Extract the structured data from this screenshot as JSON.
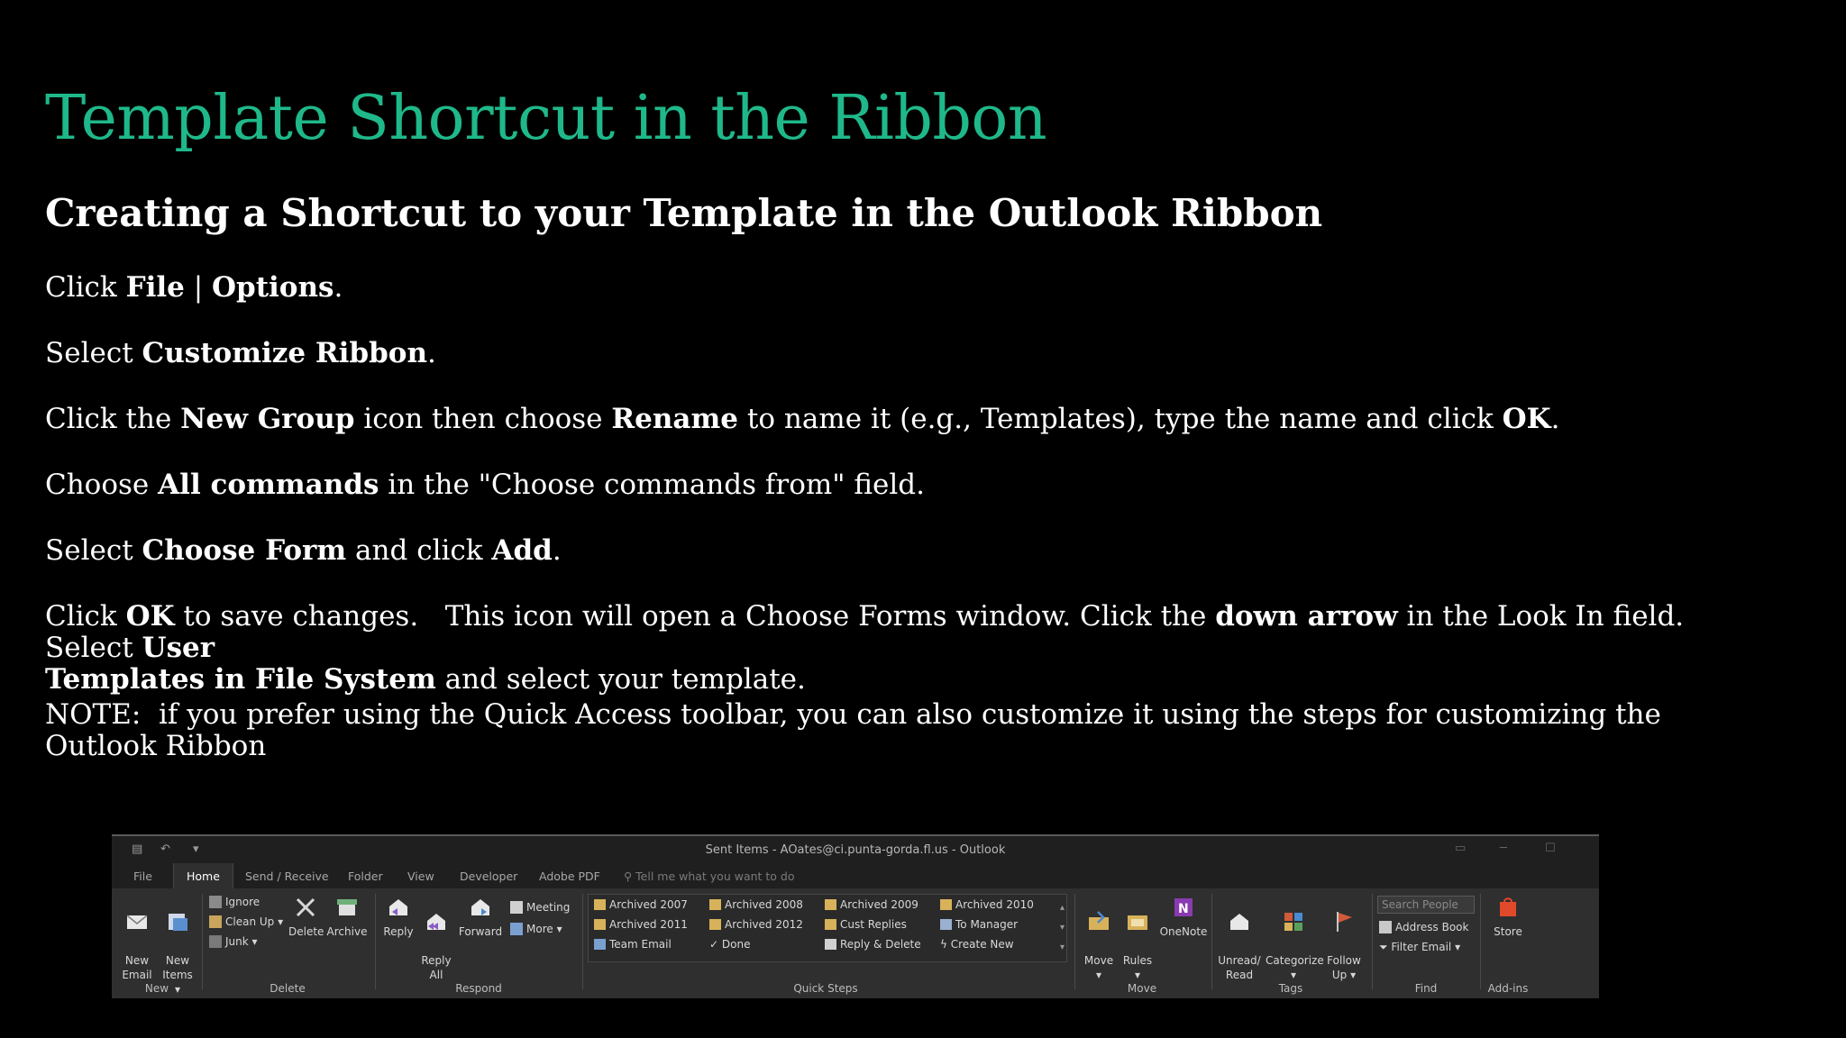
{
  "slide": {
    "title": "Template Shortcut in the Ribbon",
    "subtitle": "Creating a Shortcut to your Template in the Outlook Ribbon",
    "p1": {
      "a": "Click ",
      "b1": "File",
      "c": " | ",
      "b2": "Options",
      "d": "."
    },
    "p2": {
      "a": "Select ",
      "b1": "Customize Ribbon",
      "d": "."
    },
    "p3": {
      "a": "Click the ",
      "b1": "New Group",
      "c": " icon then choose ",
      "b2": "Rename",
      "e": " to name it (e.g., Templates), type the name and click ",
      "b3": "OK",
      "d": "."
    },
    "p4": {
      "a": "Choose ",
      "b1": "All commands",
      "c": " in the \"Choose commands from\" field."
    },
    "p5": {
      "a": "Select ",
      "b1": "Choose Form",
      "c": " and click ",
      "b2": "Add",
      "d": "."
    },
    "p6": {
      "a": "Click ",
      "b1": "OK",
      "c": " to save changes.   This icon will open a Choose Forms window. Click the ",
      "b2": "down arrow",
      "e": " in the Look In field.   Select ",
      "b3": "User",
      "f": "Templates in File System",
      "g": " and select your template."
    },
    "p7": "NOTE:  if you prefer using the Quick Access toolbar, you can also customize it using the steps for customizing the Outlook Ribbon"
  },
  "outlook": {
    "window_title": "Sent Items - AOates@ci.punta-gorda.fl.us - Outlook",
    "tabs": [
      "File",
      "Home",
      "Send / Receive",
      "Folder",
      "View",
      "Developer",
      "Adobe PDF"
    ],
    "tell_me": "Tell me what you want to do",
    "groups": {
      "new": {
        "label": "New",
        "new_email": "New\nEmail",
        "new_items": "New\nItems ▾"
      },
      "delete": {
        "label": "Delete",
        "ignore": "Ignore",
        "clean_up": "Clean Up ▾",
        "junk": "Junk ▾",
        "delete": "Delete",
        "archive": "Archive"
      },
      "respond": {
        "label": "Respond",
        "reply": "Reply",
        "reply_all": "Reply\nAll",
        "forward": "Forward",
        "meeting": "Meeting",
        "more": "More ▾"
      },
      "quick_steps": {
        "label": "Quick Steps",
        "items": [
          "Archived 2007",
          "Archived 2008",
          "Archived 2009",
          "Archived 2010",
          "Archived 2011",
          "Archived 2012",
          "Cust Replies",
          "To Manager",
          "Team Email",
          "Done",
          "Reply & Delete",
          "Create New"
        ]
      },
      "move": {
        "label": "Move",
        "move": "Move\n▾",
        "rules": "Rules\n▾",
        "onenote": "OneNote"
      },
      "tags": {
        "label": "Tags",
        "unread_read": "Unread/\nRead",
        "categorize": "Categorize\n▾",
        "follow_up": "Follow\nUp ▾"
      },
      "find": {
        "label": "Find",
        "search_people": "Search People",
        "address_book": "Address Book",
        "filter_email": "Filter Email ▾"
      },
      "addins": {
        "label": "Add-ins",
        "store": "Store"
      }
    }
  }
}
